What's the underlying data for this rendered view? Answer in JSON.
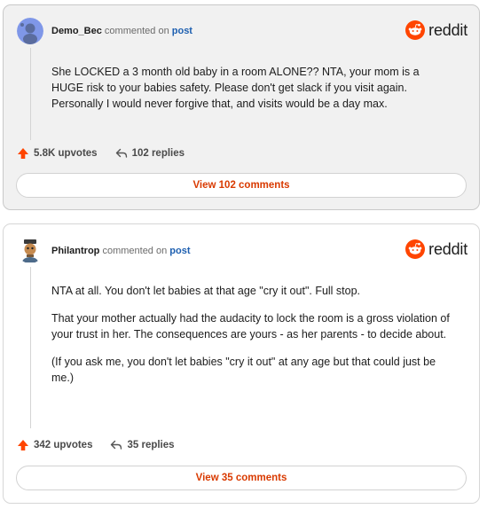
{
  "brand": {
    "word": "reddit",
    "color": "#ff4500"
  },
  "comments": [
    {
      "author": "Demo_Bec",
      "action": "commented on",
      "link": "post",
      "body": [
        "She LOCKED a 3 month old baby in a room ALONE?? NTA, your mom is a HUGE risk to your babies safety. Please don't get slack if you visit again. Personally I would never forgive that, and visits would be a day max."
      ],
      "upvotes": "5.8K upvotes",
      "replies": "102 replies",
      "view_label": "View 102 comments"
    },
    {
      "author": "Philantrop",
      "action": "commented on",
      "link": "post",
      "body": [
        "NTA at all. You don't let babies at that age \"cry it out\". Full stop.",
        "That your mother actually had the audacity to lock the room is a gross violation of your trust in her. The consequences are yours - as her parents - to decide about.",
        "(If you ask me, you don't let babies \"cry it out\" at any age but that could just be me.)"
      ],
      "upvotes": "342 upvotes",
      "replies": "35 replies",
      "view_label": "View 35 comments"
    }
  ],
  "colors": {
    "upvote": "#ff4500",
    "link": "#1d5fb0",
    "view": "#d93a00"
  }
}
